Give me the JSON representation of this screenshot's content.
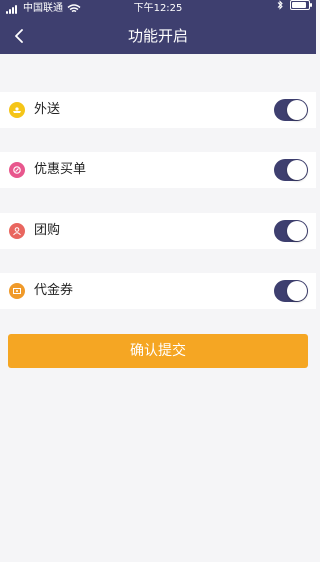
{
  "status_bar": {
    "carrier": "中国联通",
    "time": "下午12:25"
  },
  "nav": {
    "title": "功能开启"
  },
  "features": [
    {
      "label": "外送",
      "icon": "delivery-icon",
      "color": "#f5c518",
      "enabled": true
    },
    {
      "label": "优惠买单",
      "icon": "discount-icon",
      "color": "#e8578d",
      "enabled": true
    },
    {
      "label": "团购",
      "icon": "group-buy-icon",
      "color": "#e9665f",
      "enabled": true
    },
    {
      "label": "代金券",
      "icon": "voucher-icon",
      "color": "#f09a2a",
      "enabled": true
    }
  ],
  "submit_label": "确认提交",
  "colors": {
    "header": "#3e3f6f",
    "toggle_on": "#3e3f6f",
    "submit": "#f5a623",
    "background": "#f5f5f7"
  }
}
